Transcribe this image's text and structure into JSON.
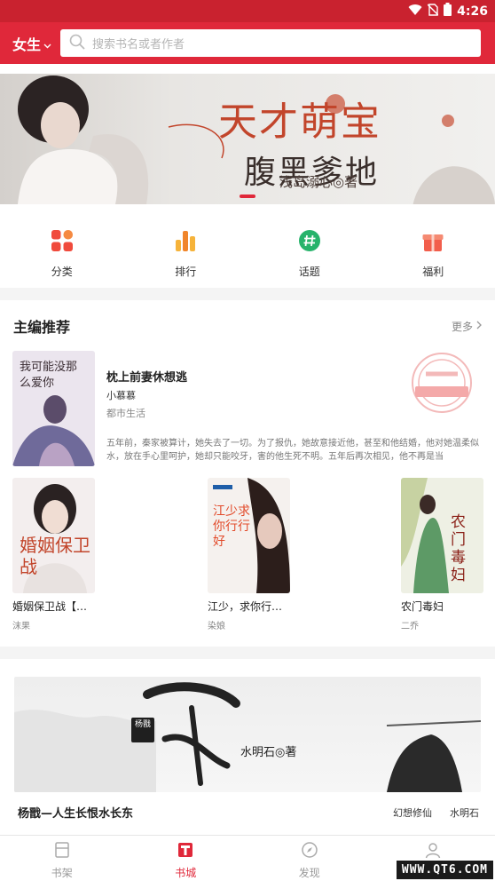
{
  "status_bar": {
    "time": "4:26"
  },
  "header": {
    "gender_label": "女生",
    "search_placeholder": "搜索书名或者作者"
  },
  "banner": {
    "title_line1": "天才萌宝",
    "title_line2": "腹黑爹地",
    "author": "浅岛溺心◎著"
  },
  "quick_nav": [
    {
      "label": "分类",
      "icon": "category-grid-icon"
    },
    {
      "label": "排行",
      "icon": "ranking-bars-icon"
    },
    {
      "label": "话题",
      "icon": "topic-hash-icon"
    },
    {
      "label": "福利",
      "icon": "gift-icon"
    }
  ],
  "editor_picks": {
    "title": "主编推荐",
    "more_label": "更多",
    "featured": {
      "title": "枕上前妻休想逃",
      "author": "小慕慕",
      "genre": "都市生活",
      "description": "五年前，秦家被算计，她失去了一切。为了报仇，她故意接近他，甚至和他结婚，他对她温柔似水，放在手心里呵护，她却只能咬牙，害的他生死不明。五年后再次相见，他不再是当",
      "cover_text": "我可能没那么爱你"
    },
    "books": [
      {
        "title": "婚姻保卫战【…",
        "author": "沫果",
        "cover_text": "婚姻保卫战"
      },
      {
        "title": "江少，求你行…",
        "author": "染娘",
        "cover_text": "江少求你行行好"
      },
      {
        "title": "农门毒妇",
        "author": "二乔",
        "cover_text": "农门毒妇"
      }
    ]
  },
  "promo": {
    "title": "杨戬—人生长恨水长东",
    "tags": [
      "幻想修仙",
      "水明石"
    ],
    "author_text": "水明石◎著",
    "seal_text": "杨戬"
  },
  "tab_bar": [
    {
      "label": "书架",
      "icon": "bookshelf-icon",
      "active": false
    },
    {
      "label": "书城",
      "icon": "bookstore-icon",
      "active": true
    },
    {
      "label": "发现",
      "icon": "compass-icon",
      "active": false
    },
    {
      "label": "我的",
      "icon": "profile-icon",
      "active": false
    }
  ],
  "watermark": "WWW.QT6.COM",
  "colors": {
    "brand_red": "#e0283a",
    "status_red": "#c9222f"
  }
}
